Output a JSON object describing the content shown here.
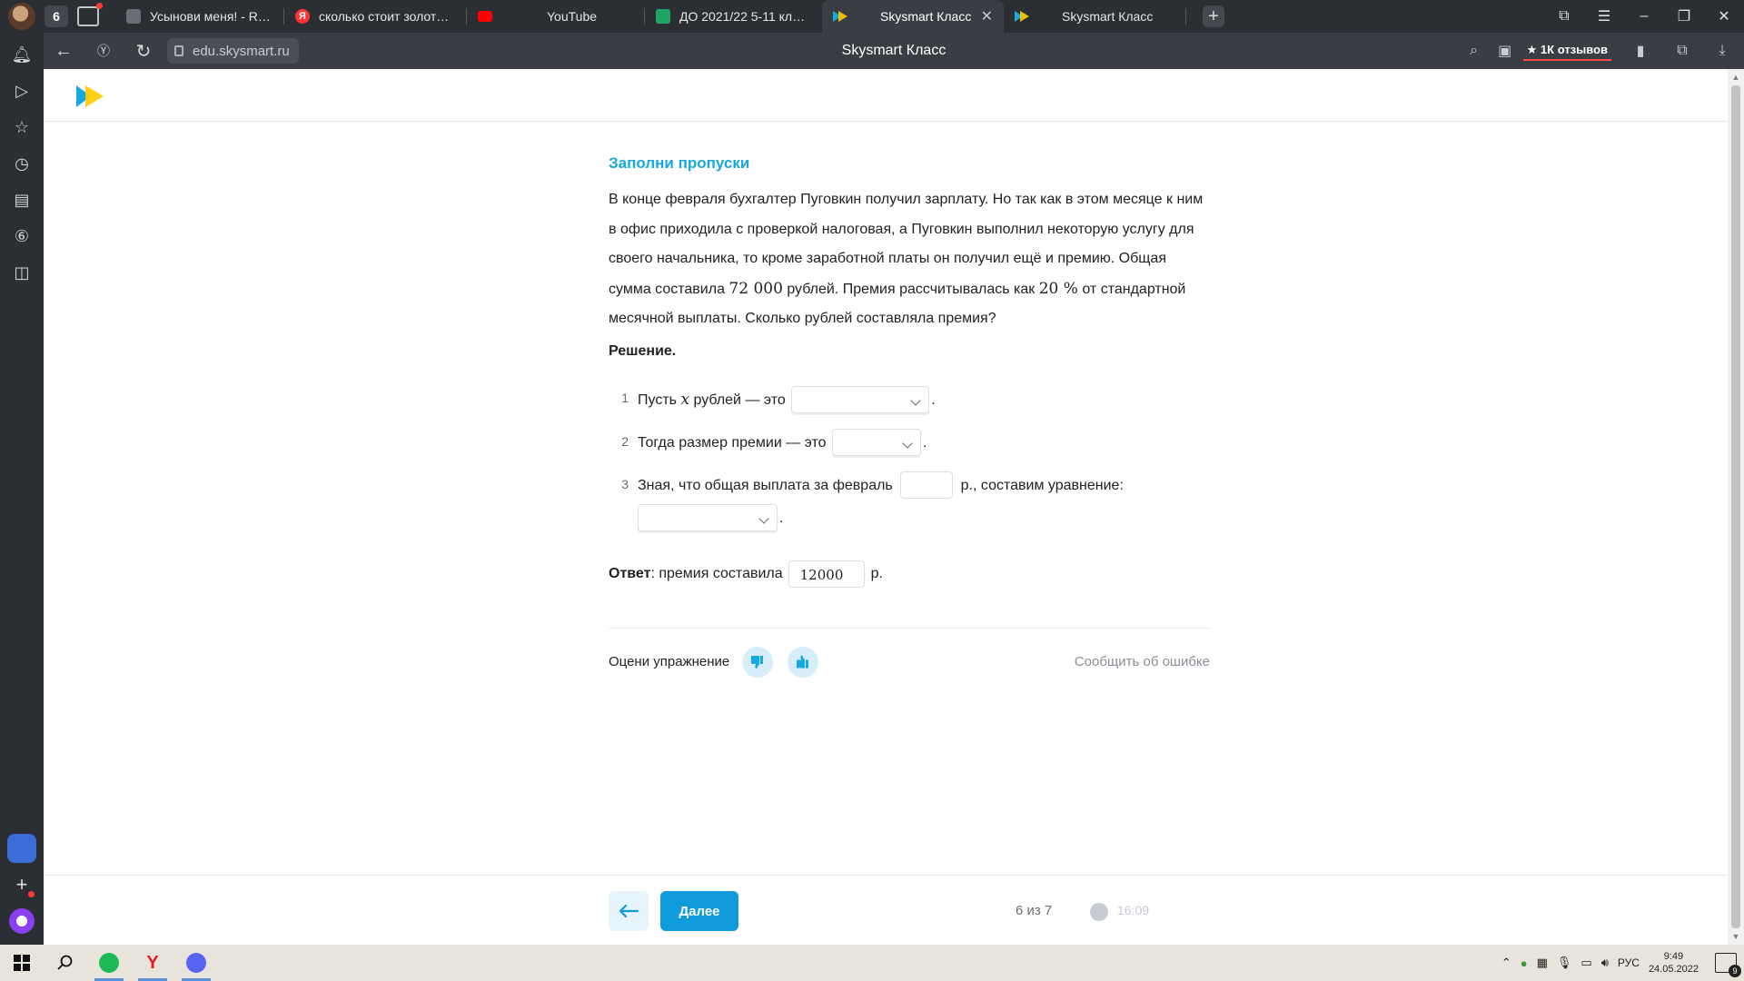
{
  "browser": {
    "tab_counter": "6",
    "tabs": [
      {
        "title": "Усынови меня! - Roblox",
        "favicon": "roblox-icon"
      },
      {
        "title": "сколько стоит золотой ед",
        "favicon": "yandex-icon"
      },
      {
        "title": "YouTube",
        "favicon": "youtube-icon"
      },
      {
        "title": "ДО 2021/22 5-11 класс - G",
        "favicon": "sheets-icon"
      },
      {
        "title": "Skysmart Класс",
        "favicon": "skysmart-icon",
        "active": true
      },
      {
        "title": "Skysmart Класс",
        "favicon": "skysmart-icon"
      }
    ],
    "url": "edu.skysmart.ru",
    "page_title": "Skysmart Класс",
    "reviews_label": "★ 1К отзывов"
  },
  "task": {
    "title": "Заполни пропуски",
    "text_1": "В конце февраля бухгалтер Пуговкин получил зарплату. Но так как в этом месяце к ним в офис приходила с проверкой налоговая, а Пуговкин выполнил некоторую услугу для своего начальника, то кроме заработной платы он получил ещё и премию. Общая сумма составила ",
    "total_sum": "72 000",
    "text_2": " рублей. Премия рассчитывалась как ",
    "percent": "20 %",
    "text_3": " от стандартной месячной выплаты. Сколько рублей составляла премия?",
    "solution_label": "Решение.",
    "steps": [
      {
        "num": "1",
        "before": "Пусть ",
        "var": "x",
        "after": " рублей — это",
        "end": "."
      },
      {
        "num": "2",
        "before": "Тогда размер премии — это",
        "end": "."
      },
      {
        "num": "3",
        "before": "Зная, что общая выплата за февраль",
        "after": "р., составим уравнение:",
        "end": "."
      }
    ],
    "answer_label": "Ответ",
    "answer_text": ": премия составила",
    "answer_value": "12000",
    "answer_unit": "р."
  },
  "rating": {
    "label": "Оцени упражнение",
    "report": "Сообщить об ошибке"
  },
  "footer": {
    "next_label": "Далее",
    "progress": "6 из 7",
    "timer": "16:09"
  },
  "taskbar": {
    "lang": "РУС",
    "time": "9:49",
    "date": "24.05.2022",
    "notifications": "9"
  },
  "colors": {
    "accent": "#0f9bdc",
    "title": "#18a8e0",
    "chrome": "#2b2e33"
  }
}
